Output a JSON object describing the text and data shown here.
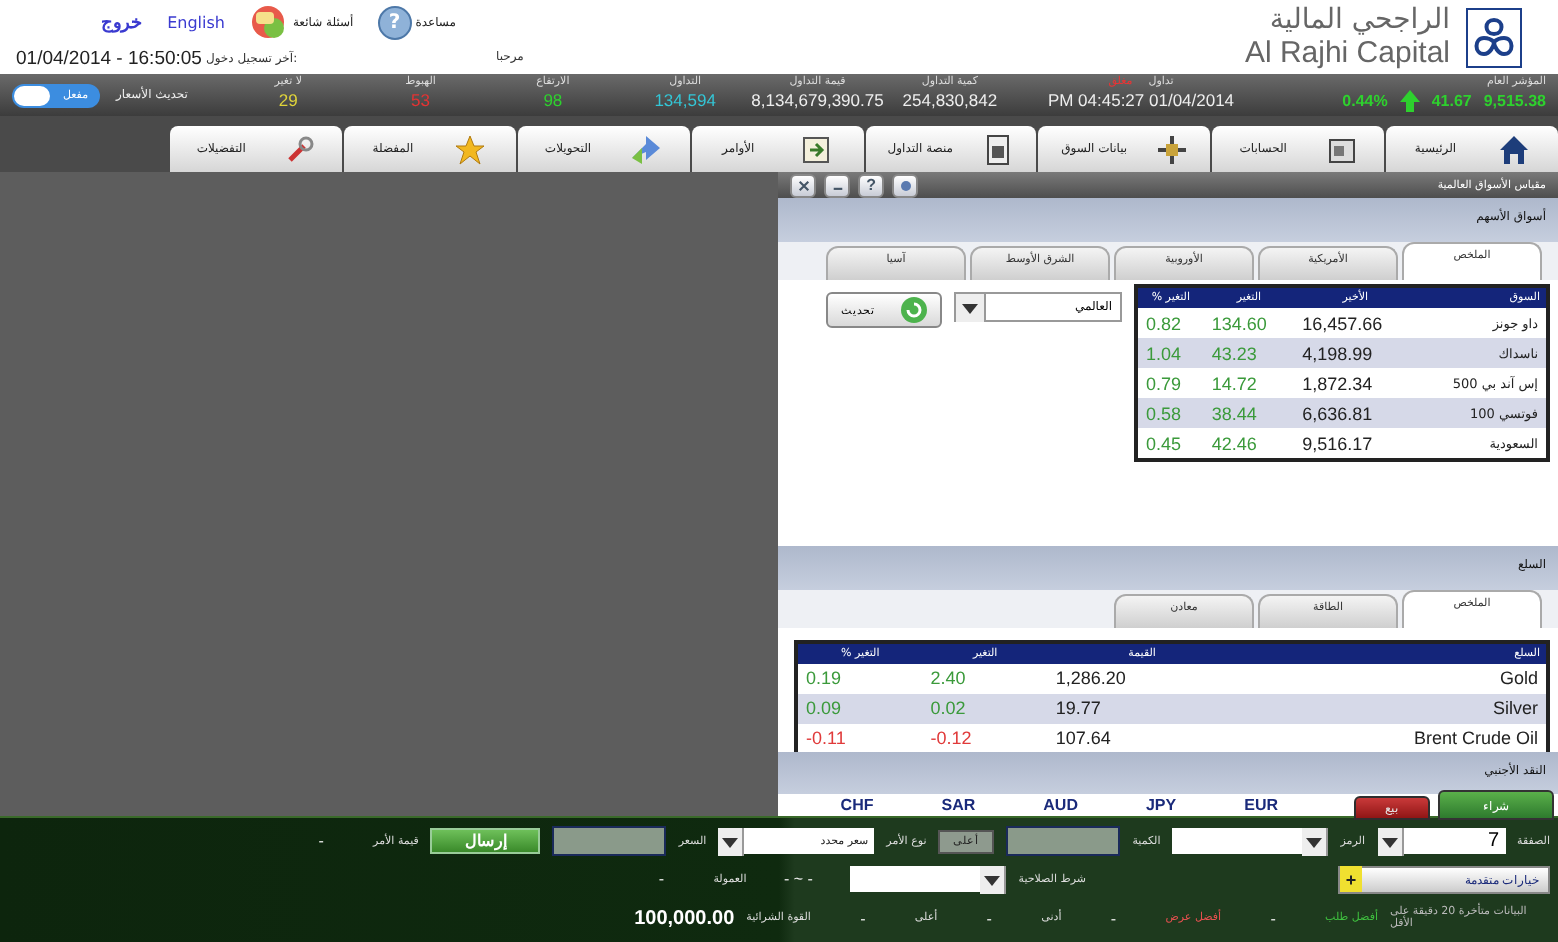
{
  "header": {
    "links": [
      {
        "label": "English"
      },
      {
        "label": "خروج"
      }
    ],
    "faq": "أسئلة شائعة",
    "help": "مساعدة",
    "help_icon": "?",
    "last_login_label": "آخر تسجيل دخول:",
    "last_login": "01/04/2014 - 16:50:05",
    "welcome": "مرحبا",
    "logo_ar": "الراجحي المالية",
    "logo_en": "Al Rajhi Capital"
  },
  "ticker": {
    "index": {
      "label": "المؤشر العام",
      "value": "9,515.38",
      "change": "41.67",
      "change_pct": "0.44%",
      "rising": true
    },
    "status": {
      "label": "تداول",
      "state": "مغلق",
      "time": "PM 04:45:27 01/04/2014"
    },
    "stats": [
      {
        "label": "كمية التداول",
        "value": "254,830,842",
        "color": "#eeeeee"
      },
      {
        "label": "قيمة التداول",
        "value": "8,134,679,390.75",
        "color": "#eeeeee"
      },
      {
        "label": "التداول",
        "value": "134,594",
        "color": "#33c6d6"
      },
      {
        "label": "الارتفاع",
        "value": "98",
        "color": "#2ed12e"
      },
      {
        "label": "الهبوط",
        "value": "53",
        "color": "#e33333"
      },
      {
        "label": "لا تغير",
        "value": "29",
        "color": "#e0d43a"
      }
    ],
    "price_update": {
      "label": "تحديث الأسعار",
      "toggle": "مفعل",
      "on": true
    }
  },
  "nav": [
    {
      "label": "الرئيسية",
      "kind": "home"
    },
    {
      "label": "الحسابات",
      "kind": "accounts"
    },
    {
      "label": "بيانات السوق",
      "kind": "market"
    },
    {
      "label": "منصة التداول",
      "kind": "platform"
    },
    {
      "label": "الأوامر",
      "kind": "orders"
    },
    {
      "label": "التحويلات",
      "kind": "transfers"
    },
    {
      "label": "المفضلة",
      "kind": "favorites"
    },
    {
      "label": "التفضيلات",
      "kind": "preferences"
    }
  ],
  "panel": {
    "title": "مقياس الأسواق العالمية",
    "help_icon": "?",
    "stocks": {
      "title": "أسواق الأسهم",
      "tabs": [
        {
          "label": "الملخص",
          "selected": true
        },
        {
          "label": "الأمريكية",
          "selected": false
        },
        {
          "label": "الأوروبية",
          "selected": false
        },
        {
          "label": "الشرق الأوسط",
          "selected": false
        },
        {
          "label": "آسيا",
          "selected": false
        }
      ],
      "region": "العالمي",
      "refresh": "تحديث",
      "columns": [
        "السوق",
        "الأخير",
        "التغير",
        "التغير %"
      ],
      "rows": [
        {
          "name": "داو جونز",
          "last": "16,457.66",
          "change": "134.60",
          "change_pct": "0.82",
          "negative": false
        },
        {
          "name": "ناسداك",
          "last": "4,198.99",
          "change": "43.23",
          "change_pct": "1.04",
          "negative": false
        },
        {
          "name": "إس آند بي 500",
          "last": "1,872.34",
          "change": "14.72",
          "change_pct": "0.79",
          "negative": false
        },
        {
          "name": "فوتسي 100",
          "last": "6,636.81",
          "change": "38.44",
          "change_pct": "0.58",
          "negative": false
        },
        {
          "name": "السعودية",
          "last": "9,516.17",
          "change": "42.46",
          "change_pct": "0.45",
          "negative": false
        }
      ]
    },
    "commodities": {
      "title": "السلع",
      "tabs": [
        {
          "label": "الملخص",
          "selected": true
        },
        {
          "label": "الطاقة",
          "selected": false
        },
        {
          "label": "معادن",
          "selected": false
        }
      ],
      "columns": [
        "السلع",
        "القيمة",
        "التغير",
        "التغير %"
      ],
      "rows": [
        {
          "name": "Gold",
          "last": "1,286.20",
          "change": "2.40",
          "change_pct": "0.19",
          "negative": false
        },
        {
          "name": "Silver",
          "last": "19.77",
          "change": "0.02",
          "change_pct": "0.09",
          "negative": false
        },
        {
          "name": "Brent Crude Oil",
          "last": "107.64",
          "change": "0.12-",
          "change_pct": "0.11-",
          "negative": true
        }
      ]
    },
    "forex": {
      "title": "النقد الأجنبي",
      "codes": [
        "EUR",
        "JPY",
        "AUD",
        "SAR",
        "CHF"
      ]
    }
  },
  "trade_buttons": [
    {
      "label": "شراء",
      "kind": "buy",
      "selected": true
    },
    {
      "label": "بيع",
      "kind": "sell",
      "selected": false
    }
  ],
  "order_panel": {
    "trade_line": [
      {
        "kind": "label",
        "text": "الصفقة"
      },
      {
        "kind": "spinner",
        "text": "7"
      },
      {
        "kind": "label",
        "text": "الرمز"
      },
      {
        "kind": "select"
      },
      {
        "kind": "label",
        "text": "الكمية"
      },
      {
        "kind": "input"
      },
      {
        "kind": "button",
        "text": "أعلى"
      },
      {
        "kind": "label",
        "text": "نوع الأمر"
      },
      {
        "kind": "select",
        "text": "سعر محدد"
      },
      {
        "kind": "label",
        "text": "السعر"
      },
      {
        "kind": "input"
      },
      {
        "kind": "send",
        "text": "إرسال"
      },
      {
        "kind": "label",
        "text": "قيمة الأمر"
      },
      {
        "kind": "value",
        "text": "-"
      }
    ],
    "options_line": [
      {
        "kind": "advanced",
        "text": "خيارات متقدمة",
        "icon": "+"
      },
      {
        "kind": "label",
        "text": "شرط الصلاحية"
      },
      {
        "kind": "select"
      },
      {
        "kind": "value",
        "text": "- ~ -"
      },
      {
        "kind": "label",
        "text": "العمولة"
      },
      {
        "kind": "value",
        "text": "-"
      }
    ],
    "market_line": [
      {
        "kind": "note",
        "text": "البيانات متأخرة 20 دقيقة على الأقل"
      },
      {
        "kind": "label",
        "text": "أفضل طلب",
        "color": "#3fc03f"
      },
      {
        "kind": "value",
        "text": "-"
      },
      {
        "kind": "label",
        "text": "أفضل عرض",
        "color": "#e85050"
      },
      {
        "kind": "value",
        "text": "-"
      },
      {
        "kind": "label",
        "text": "أدنى"
      },
      {
        "kind": "value",
        "text": "-"
      },
      {
        "kind": "label",
        "text": "أعلى"
      },
      {
        "kind": "value",
        "text": "-"
      },
      {
        "kind": "label",
        "text": "القوة الشرائية"
      },
      {
        "kind": "total",
        "text": "100,000.00"
      }
    ]
  }
}
